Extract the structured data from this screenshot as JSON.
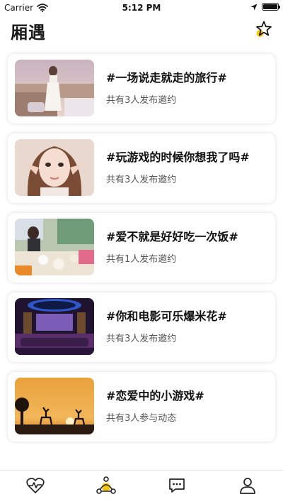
{
  "status_bar": {
    "carrier": "Carrier",
    "time": "5:12 PM",
    "icons": [
      "wifi-icon",
      "location-arrow-icon",
      "battery-icon"
    ]
  },
  "header": {
    "title": "厢遇",
    "action_icon": "star-icon"
  },
  "topics": [
    {
      "title": "#一场说走就走的旅行#",
      "subtitle": "共有3人发布邀约",
      "image": "travel-photo"
    },
    {
      "title": "#玩游戏的时候你想我了吗#",
      "subtitle": "共有3人发布邀约",
      "image": "girl-portrait-photo"
    },
    {
      "title": "#爱不就是好好吃一次饭#",
      "subtitle": "共有1人发布邀约",
      "image": "dining-photo"
    },
    {
      "title": "#你和电影可乐爆米花#",
      "subtitle": "共有3人发布邀约",
      "image": "cinema-room-photo"
    },
    {
      "title": "#恋爱中的小游戏#",
      "subtitle": "共有3人参与动态",
      "image": "sunset-deer-photo"
    }
  ],
  "tab_bar": {
    "tabs": [
      "heart-pulse-icon",
      "group-icon",
      "chat-icon",
      "profile-icon"
    ],
    "active_index": 1
  },
  "colors": {
    "accent": "#f5c518",
    "text_primary": "#111111",
    "text_secondary": "#555555"
  }
}
